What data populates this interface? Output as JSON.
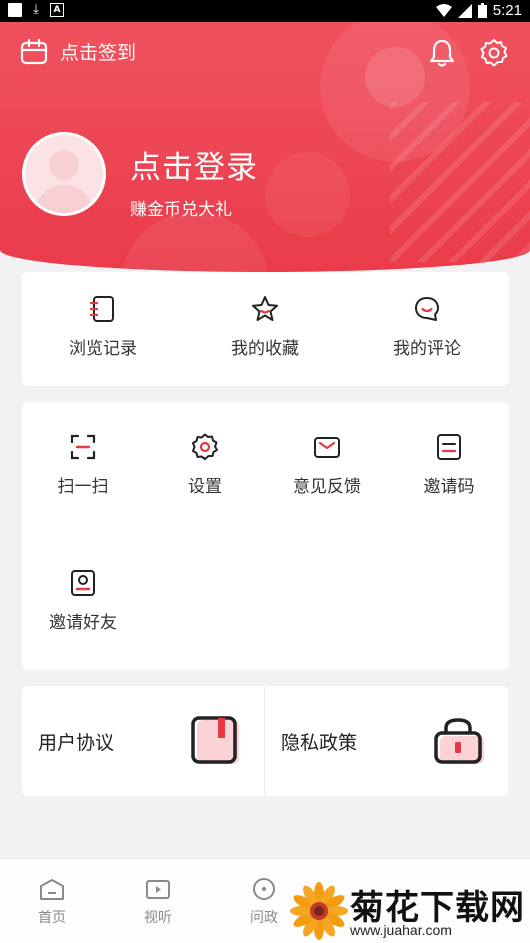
{
  "status_bar": {
    "time": "5:21"
  },
  "header": {
    "checkin_label": "点击签到",
    "login_title": "点击登录",
    "login_subtitle": "赚金币兑大礼"
  },
  "quick_links": [
    {
      "label": "浏览记录",
      "icon": "notebook-icon"
    },
    {
      "label": "我的收藏",
      "icon": "star-icon"
    },
    {
      "label": "我的评论",
      "icon": "comment-icon"
    }
  ],
  "tools": [
    {
      "label": "扫一扫",
      "icon": "scan-icon"
    },
    {
      "label": "设置",
      "icon": "gear-icon"
    },
    {
      "label": "意见反馈",
      "icon": "envelope-icon"
    },
    {
      "label": "邀请码",
      "icon": "code-doc-icon"
    },
    {
      "label": "邀请好友",
      "icon": "contact-card-icon"
    }
  ],
  "agreements": {
    "user_agreement": "用户协议",
    "privacy_policy": "隐私政策"
  },
  "bottom_nav": [
    {
      "label": "首页",
      "icon": "home-icon"
    },
    {
      "label": "视听",
      "icon": "video-icon"
    },
    {
      "label": "问政",
      "icon": "question-icon"
    }
  ],
  "watermark": {
    "title": "菊花下载网",
    "url": "www.juahar.com"
  },
  "colors": {
    "accent": "#ea3b4a",
    "header_top": "#f0515e"
  }
}
